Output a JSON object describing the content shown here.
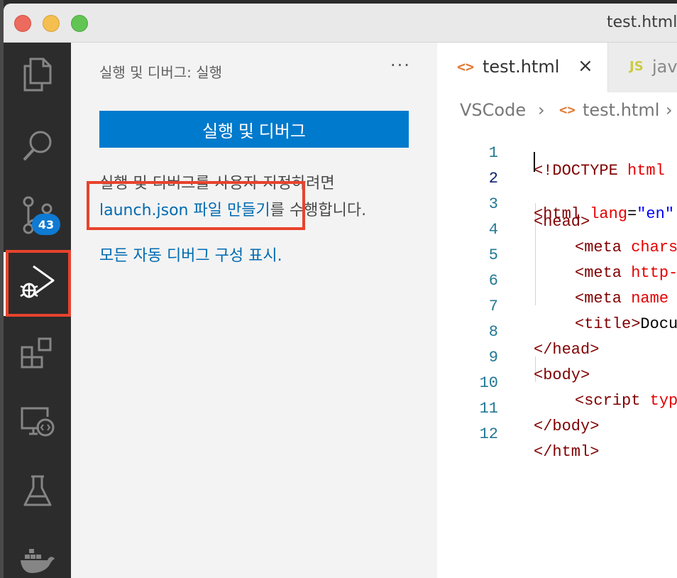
{
  "window": {
    "title": "test.html"
  },
  "activity_bar": {
    "items": [
      {
        "icon": "explorer-files-icon"
      },
      {
        "icon": "search-icon"
      },
      {
        "icon": "source-control-icon",
        "badge": "43"
      },
      {
        "icon": "run-and-debug-icon",
        "active": true
      },
      {
        "icon": "extensions-icon"
      },
      {
        "icon": "remote-explorer-icon"
      },
      {
        "icon": "testing-flask-icon"
      },
      {
        "icon": "docker-whale-icon"
      }
    ]
  },
  "sidebar": {
    "title": "실행 및 디버그: 실행",
    "more": "···",
    "run_button": "실행 및 디버그",
    "customize_line1": "실행 및 디버그를 사용자 지정하려면",
    "customize_link": "launch.json 파일 만들기",
    "customize_rest": "를 수행합니다.",
    "show_all_link": "모든 자동 디버그 구성 표시."
  },
  "editor": {
    "tabs": [
      {
        "icon": "<>",
        "label": "test.html",
        "close": "×"
      },
      {
        "icon": "JS",
        "label": "jav"
      }
    ],
    "breadcrumb": {
      "folder": "VSCode",
      "sep": "›",
      "file_icon": "<>",
      "file": "test.html"
    },
    "lines": [
      {
        "n": "1"
      },
      {
        "n": "2"
      },
      {
        "n": "3"
      },
      {
        "n": "4"
      },
      {
        "n": "5"
      },
      {
        "n": "6"
      },
      {
        "n": "7"
      },
      {
        "n": "8"
      },
      {
        "n": "9"
      },
      {
        "n": "10"
      },
      {
        "n": "11"
      },
      {
        "n": "12"
      }
    ]
  },
  "code": {
    "l1a": "<!DOCTYPE ",
    "l1b": "html",
    "l2a": "<html ",
    "l2b": "lang",
    "l2c": "=",
    "l2d": "\"en\"",
    "l3": "<head>",
    "l4a": "<meta ",
    "l4b": "charse",
    "l5a": "<meta ",
    "l5b": "http-",
    "l6a": "<meta ",
    "l6b": "name",
    "l7a": "<title>",
    "l7b": "Docum",
    "l8": "</head>",
    "l9": "<body>",
    "l10a": "<script ",
    "l10b": "type",
    "l11": "</body>",
    "l12": "</html>"
  },
  "colors": {
    "accent_button": "#007acc",
    "highlight_box": "#e8432d",
    "link": "#006ab1",
    "badge": "#0e7ad3"
  }
}
